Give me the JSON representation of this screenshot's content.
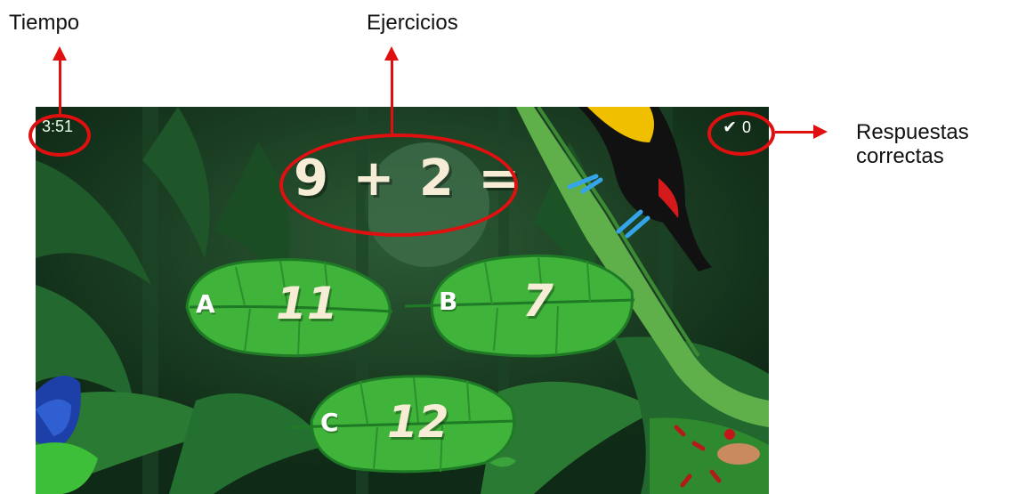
{
  "annotations": {
    "tiempo": "Tiempo",
    "ejercicios": "Ejercicios",
    "respuestas_line1": "Respuestas",
    "respuestas_line2": "correctas"
  },
  "hud": {
    "timer": "3:51",
    "check_icon": "✔",
    "correct_count": "0"
  },
  "exercise": {
    "equation": "9 + 2 ="
  },
  "options": [
    {
      "letter": "A",
      "value": "11"
    },
    {
      "letter": "B",
      "value": "7"
    },
    {
      "letter": "C",
      "value": "12"
    }
  ],
  "colors": {
    "annotation_red": "#e01010",
    "leaf_green": "#3fb33a",
    "leaf_dark": "#1f7a26",
    "text_cream": "#f7ecd6"
  },
  "icons": [
    "check-icon",
    "toucan-icon",
    "butterfly-icon",
    "frog-icon",
    "moon-icon"
  ]
}
